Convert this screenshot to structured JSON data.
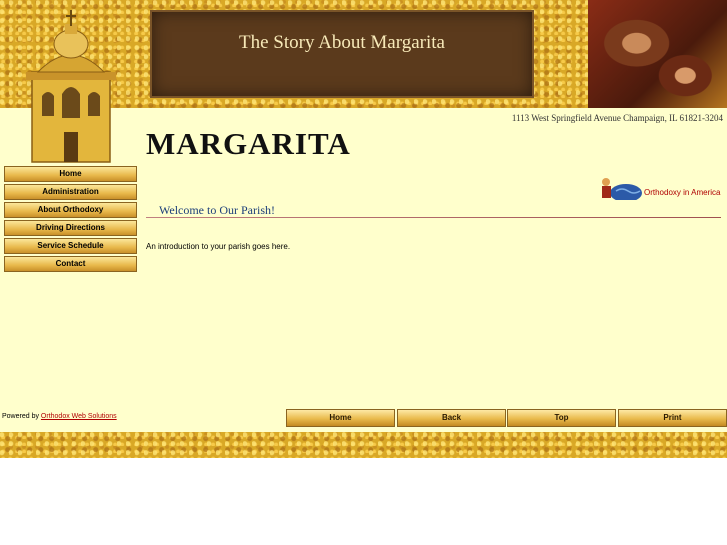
{
  "header": {
    "site_title": "The Story About Margarita",
    "address": "1113 West Springfield Avenue  Champaign, IL  61821-3204"
  },
  "parish_name": "MARGARITA",
  "nav": [
    {
      "label": "Home"
    },
    {
      "label": "Administration"
    },
    {
      "label": "About Orthodoxy"
    },
    {
      "label": "Driving Directions"
    },
    {
      "label": "Service Schedule"
    },
    {
      "label": "Contact"
    }
  ],
  "oia": {
    "label": "Orthodoxy in America"
  },
  "content": {
    "welcome_heading": "Welcome to Our Parish!",
    "intro_text": "An introduction to your parish goes here."
  },
  "footer": {
    "powered_by": "Powered by",
    "powered_link": "Orthodox Web Solutions",
    "buttons": [
      {
        "label": "Home"
      },
      {
        "label": "Back"
      },
      {
        "label": "Top"
      },
      {
        "label": "Print"
      }
    ]
  },
  "colors": {
    "page_background": "#ffffcc",
    "gold_texture": "#d9a826",
    "title_panel": "#5b3a1c",
    "heading_blue": "#1c3f7a",
    "link_red": "#b00000"
  }
}
